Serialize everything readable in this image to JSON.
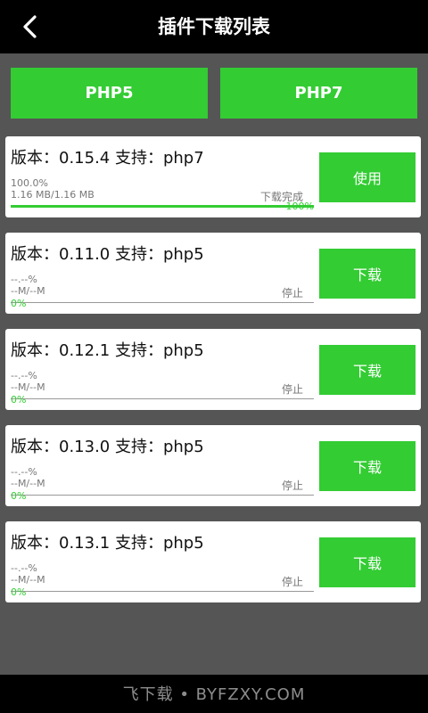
{
  "header": {
    "title": "插件下载列表"
  },
  "tabs": [
    "PHP5",
    "PHP7"
  ],
  "plugins": [
    {
      "version_label": "版本：0.15.4 支持：php7",
      "percent": "100.0%",
      "size": "1.16 MB/1.16 MB",
      "status": "下载完成",
      "progress_label": "100%",
      "progress": 1.0,
      "action": "使用"
    },
    {
      "version_label": "版本：0.11.0 支持：php5",
      "percent": "--.--%",
      "size": "--M/--M",
      "status": "停止",
      "progress_label": "0%",
      "progress": 0,
      "action": "下载"
    },
    {
      "version_label": "版本：0.12.1 支持：php5",
      "percent": "--.--%",
      "size": "--M/--M",
      "status": "停止",
      "progress_label": "0%",
      "progress": 0,
      "action": "下载"
    },
    {
      "version_label": "版本：0.13.0 支持：php5",
      "percent": "--.--%",
      "size": "--M/--M",
      "status": "停止",
      "progress_label": "0%",
      "progress": 0,
      "action": "下载"
    },
    {
      "version_label": "版本：0.13.1 支持：php5",
      "percent": "--.--%",
      "size": "--M/--M",
      "status": "停止",
      "progress_label": "0%",
      "progress": 0,
      "action": "下载"
    }
  ],
  "watermark": "飞下载 • BYFZXY.COM",
  "colors": {
    "accent": "#33cc33",
    "background": "#555555",
    "topbar": "#000000"
  }
}
